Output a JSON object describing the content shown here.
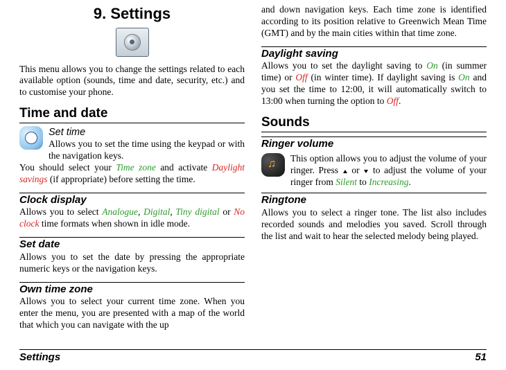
{
  "chapter": {
    "number_title": "9. Settings"
  },
  "intro": "This menu allows you to change the settings related to each available option (sounds, time and date, security, etc.) and to customise your phone.",
  "time_and_date": {
    "heading": "Time and date",
    "set_time": {
      "label": "Set time",
      "text": "Allows you to set the time using the keypad or with the navigation keys."
    },
    "advice_pre": "You should select your ",
    "advice_tz": "Time zone",
    "advice_mid1": " and activate ",
    "advice_ds": "Daylight savings",
    "advice_post": " (if appropriate) before setting the time.",
    "clock_display": {
      "label": "Clock display",
      "pre": "Allows you to select ",
      "opt1": "Analogue",
      "sep1": ", ",
      "opt2": "Digital",
      "sep2": ", ",
      "opt3": "Tiny digital",
      "sep3": " or ",
      "opt4": "No clock",
      "post": " time formats when shown in idle mode."
    },
    "set_date": {
      "label": "Set date",
      "text": "Allows you to set the date by pressing the appropriate numeric keys or the navigation keys."
    },
    "own_tz": {
      "label": "Own time zone",
      "text_a": "Allows you to select your current time zone. When you enter the menu, you are presented with a map of the world that which you can navigate with the up ",
      "text_b": "and down navigation keys. Each time zone is identified according to its position relative to Greenwich Mean Time (GMT) and by the main cities within that time zone."
    },
    "daylight": {
      "label": "Daylight saving",
      "t1": "Allows you to set the daylight saving to ",
      "on": "On",
      "t2": " (in summer time) or ",
      "off1": "Off",
      "t3": " (in winter time). If daylight saving is ",
      "on2": "On",
      "t4": " and you set the time to 12:00, it will automatically switch to 13:00 when turning the option to ",
      "off2": "Off",
      "t5": "."
    }
  },
  "sounds": {
    "heading": "Sounds",
    "ringer_volume": {
      "label": "Ringer volume",
      "t1": "This option allows you to adjust the volume of your ringer. Press ",
      "t2": " or ",
      "t3": " to adjust the volume of your ringer from ",
      "silent": "Silent",
      "t4": " to ",
      "increasing": "Increasing",
      "t5": "."
    },
    "ringtone": {
      "label": "Ringtone",
      "text": "Allows you to select a ringer tone. The list also includes recorded sounds and melodies you saved. Scroll through the list and wait to hear the selected melody being played."
    }
  },
  "footer": {
    "section": "Settings",
    "page": "51"
  }
}
